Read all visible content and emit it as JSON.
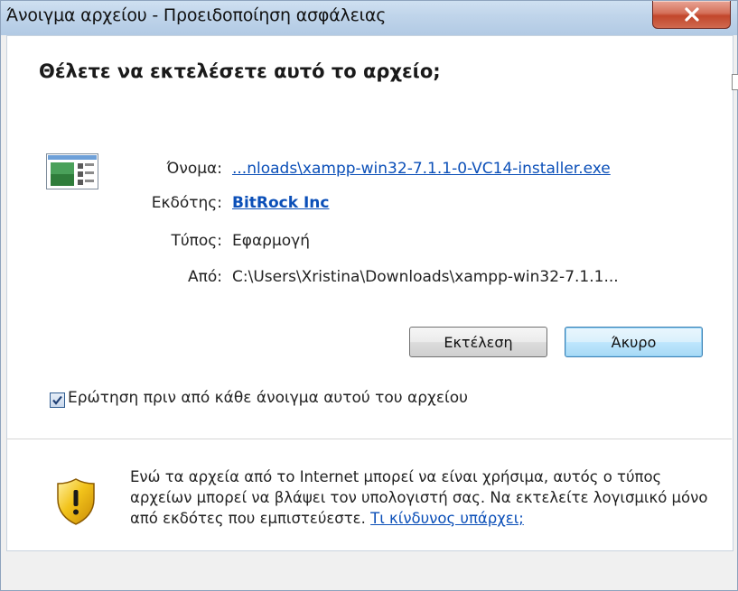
{
  "window": {
    "title": "Άνοιγμα αρχείου - Προειδοποίηση ασφάλειας"
  },
  "heading": "Θέλετε να εκτελέσετε αυτό το αρχείο;",
  "details": {
    "name_label": "Όνομα:",
    "name_value": "...nloads\\xampp-win32-7.1.1-0-VC14-installer.exe",
    "publisher_label": "Εκδότης:",
    "publisher_value": "BitRock Inc",
    "type_label": "Τύπος:",
    "type_value": "Εφαρμογή",
    "from_label": "Από:",
    "from_value": "C:\\Users\\Xristina\\Downloads\\xampp-win32-7.1.1..."
  },
  "buttons": {
    "run_label": "Εκτέλεση",
    "cancel_label": "Άκυρο"
  },
  "checkbox": {
    "label": "Ερώτηση πριν από κάθε άνοιγμα αυτού του αρχείου",
    "checked": true
  },
  "warning": {
    "text": "Ενώ τα αρχεία από το Internet μπορεί να είναι χρήσιμα, αυτός ο τύπος αρχείων μπορεί να βλάψει τον υπολογιστή σας. Να εκτελείτε λογισμικό μόνο από εκδότες που εμπιστεύεστε. ",
    "link": "Τι κίνδυνος υπάρχει;"
  },
  "icons": {
    "close": "close-icon",
    "file": "application-file-icon",
    "checkbox": "checkmark-icon",
    "warning": "security-shield-icon"
  },
  "colors": {
    "link": "#0b4fb8",
    "close_button": "#c2462b",
    "shield_yellow": "#f2c31b"
  }
}
